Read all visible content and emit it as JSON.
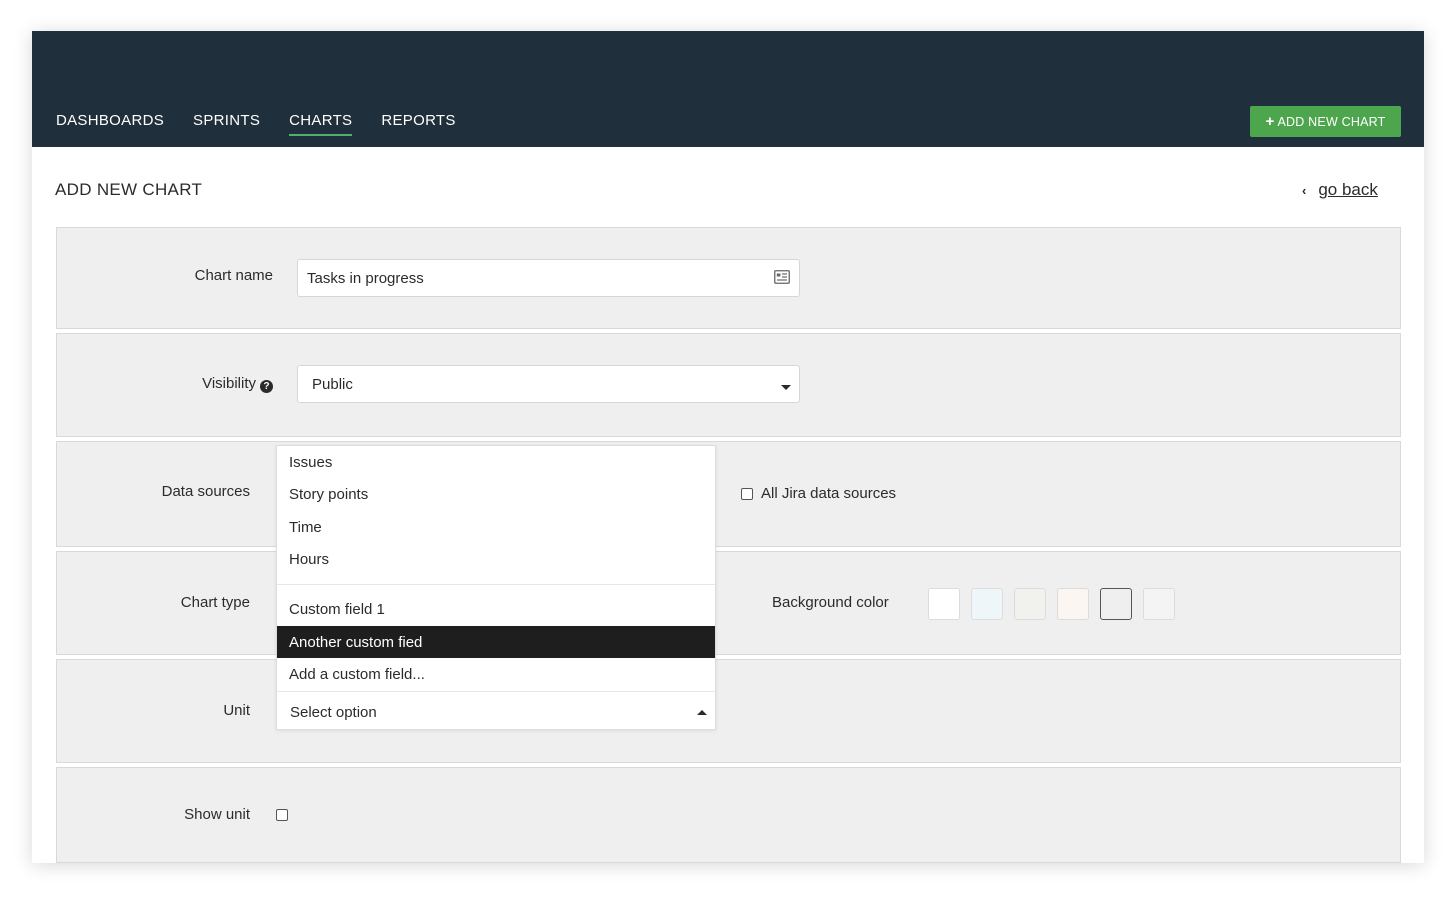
{
  "nav": {
    "items": [
      {
        "label": "DASHBOARDS"
      },
      {
        "label": "SPRINTS"
      },
      {
        "label": "CHARTS",
        "active": true
      },
      {
        "label": "REPORTS"
      }
    ],
    "add_button": "ADD NEW CHART",
    "add_button_icon": "plus-icon"
  },
  "page": {
    "title": "ADD NEW CHART",
    "go_back": "go back"
  },
  "form": {
    "chart_name": {
      "label": "Chart name",
      "value": "Tasks in progress",
      "icon": "contact-card-icon"
    },
    "visibility": {
      "label": "Visibility",
      "value": "Public",
      "help_icon": "?"
    },
    "data_sources": {
      "label": "Data sources",
      "all_jira_label": "All Jira data sources",
      "all_jira_checked": false
    },
    "chart_type": {
      "label": "Chart type"
    },
    "background_color": {
      "label": "Background color",
      "swatches": [
        "#ffffff",
        "#eef6fa",
        "#f1f1ee",
        "#fbf6f2",
        "#efefef",
        "#f4f4f4"
      ],
      "selected_index": 4
    },
    "unit": {
      "label": "Unit",
      "value": "Select option",
      "options_group1": [
        "Issues",
        "Story points",
        "Time",
        "Hours"
      ],
      "options_group2": [
        "Custom field 1",
        "Another custom fied",
        "Add a custom field..."
      ],
      "highlighted": "Another custom fied"
    },
    "show_unit": {
      "label": "Show unit",
      "checked": false
    }
  }
}
